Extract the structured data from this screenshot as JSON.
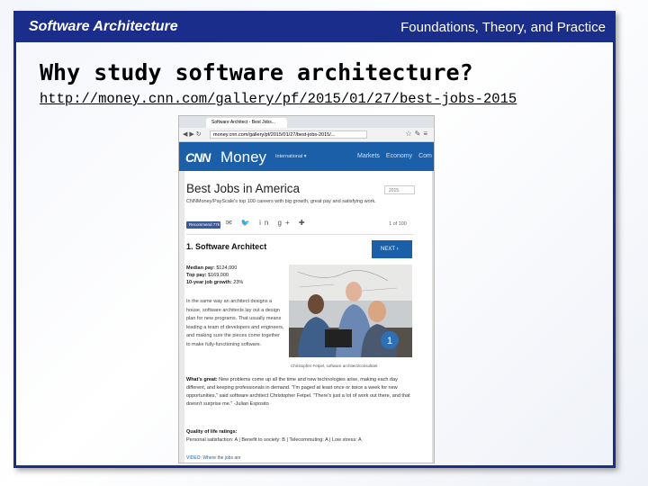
{
  "slide": {
    "header_left": "Software Architecture",
    "header_right": "Foundations, Theory, and Practice",
    "title": "Why study software architecture?",
    "url": "http://money.cnn.com/gallery/pf/2015/01/27/best-jobs-2015"
  },
  "browser": {
    "tab_title": "Software Architect - Best Jobs...",
    "address": "money.cnn.com/gallery/pf/2015/01/27/best-jobs-2015/..."
  },
  "site": {
    "logo_cnn": "CNN",
    "logo_money": "Money",
    "edition": "International ▾",
    "nav": [
      "Markets",
      "Economy",
      "Com"
    ]
  },
  "article": {
    "title": "Best Jobs in America",
    "year_select": "2015",
    "subtitle": "CNNMoney/PayScale's top 100 careers with big growth, great pay and satisfying work.",
    "recommend_label": "Recommend 77k",
    "count": "1 of 100",
    "job_title": "1. Software Architect",
    "next_label": "NEXT",
    "stats": [
      {
        "label": "Median pay:",
        "value": "$124,000"
      },
      {
        "label": "Top pay:",
        "value": "$169,000"
      },
      {
        "label": "10-year job growth:",
        "value": "23%"
      }
    ],
    "description": "In the same way an architect designs a house, software architects lay out a design plan for new programs. That usually means leading a team of developers and engineers, and making sure the pieces come together to make fully-functioning software.",
    "photo_badge": "1",
    "caption": "Christopher Fetpel, software architect/consultant",
    "whats_great_label": "What's great:",
    "whats_great_text": "New problems come up all the time and new technologies arise, making each day different, and keeping professionals in demand. \"I'm paged at least once or twice a week for new opportunities,\" said software architect Christopher Fetpel. \"There's just a lot of work out there, and that doesn't surprise me.\" -Julian Esposito",
    "quality_label": "Quality of life ratings:",
    "quality_text": "Personal satisfaction: A | Benefit to society: B | Telecommuting: A | Low stress: A",
    "bottom_link": "VIDEO: Where the jobs are"
  }
}
